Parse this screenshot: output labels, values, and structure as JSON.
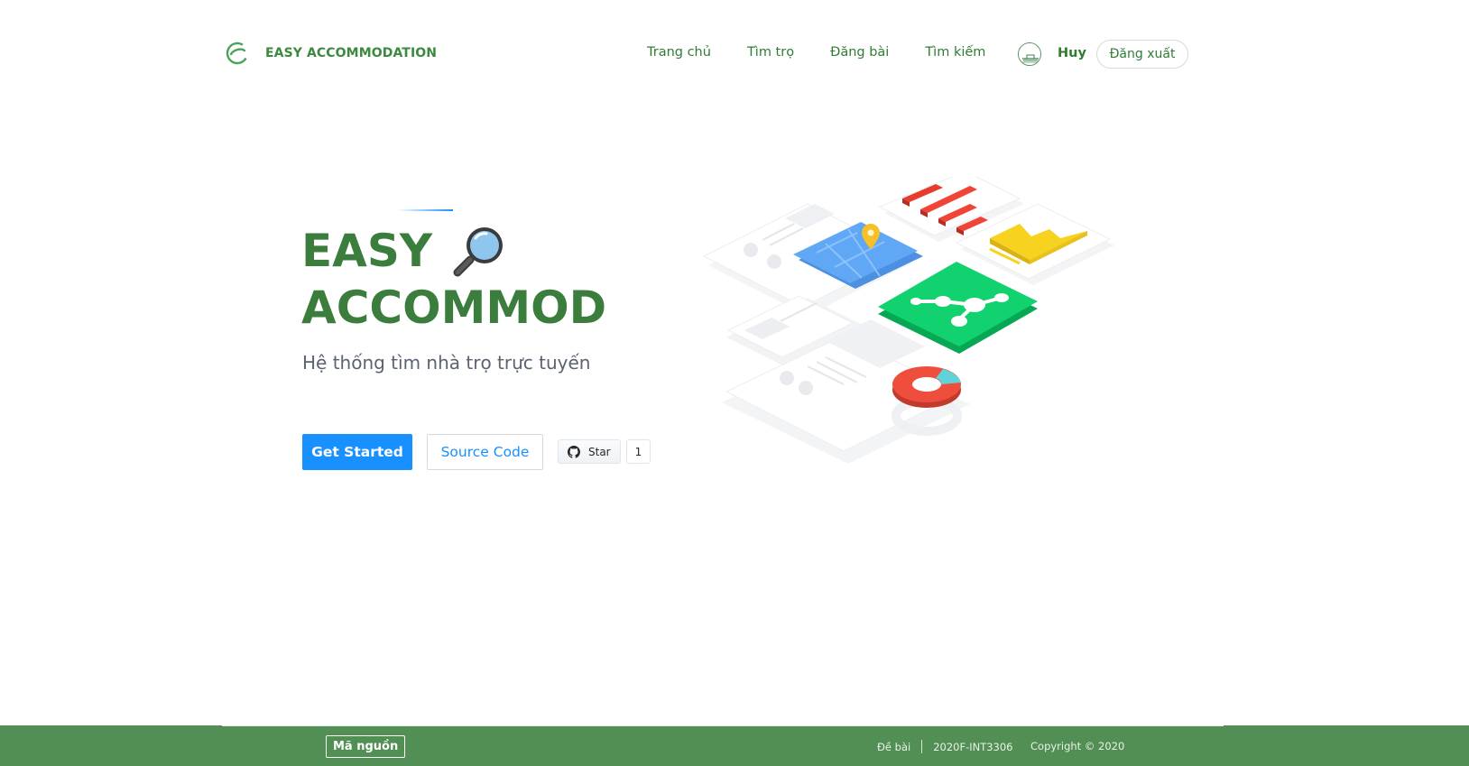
{
  "header": {
    "brand": "EASY ACCOMMODATION",
    "nav": [
      "Trang chủ",
      "Tìm trọ",
      "Đăng bài",
      "Tìm kiếm"
    ],
    "username": "Huy",
    "logout_label": "Đăng xuất"
  },
  "hero": {
    "title_line1": "EASY",
    "title_line2": "ACCOMMOD",
    "subtitle": "Hệ thống tìm nhà trọ trực tuyến",
    "get_started_label": "Get Started",
    "source_code_label": "Source Code",
    "github_star_label": "Star",
    "github_star_count": "1"
  },
  "footer": {
    "source_label": "Mã nguồn",
    "links": [
      "Đề bài",
      "2020F-INT3306"
    ],
    "copyright": "Copyright © 2020"
  },
  "colors": {
    "brand_green": "#3a7d3c",
    "primary_blue": "#1890ff",
    "footer_green": "#518f54"
  }
}
